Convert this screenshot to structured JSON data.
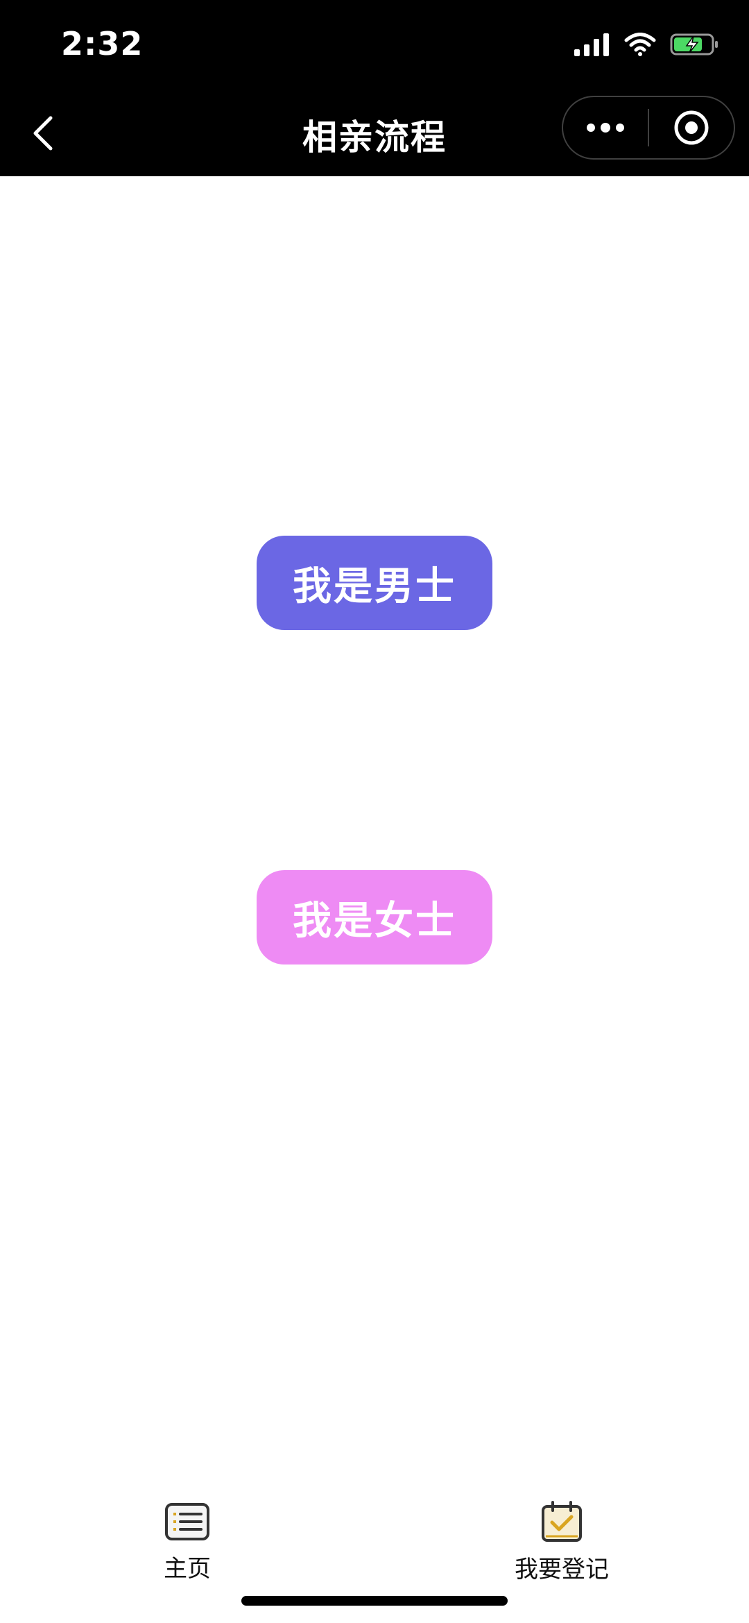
{
  "status_bar": {
    "time": "2:32"
  },
  "nav": {
    "title": "相亲流程"
  },
  "choices": {
    "male_label": "我是男士",
    "female_label": "我是女士",
    "male_color": "#6b67e4",
    "female_color": "#ee8bf4"
  },
  "tab_bar": {
    "items": [
      {
        "label": "主页",
        "icon": "list-icon"
      },
      {
        "label": "我要登记",
        "icon": "calendar-check-icon"
      }
    ],
    "accent": "#d9a521"
  }
}
